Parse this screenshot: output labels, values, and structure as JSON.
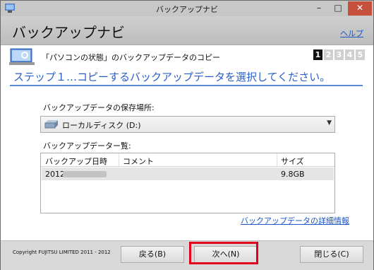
{
  "window": {
    "title": "バックアップナビ",
    "min_glyph": "–",
    "max_glyph": "□",
    "close_glyph": "✕"
  },
  "header": {
    "app_title": "バックアップナビ",
    "help_link": "ヘルプ"
  },
  "step": {
    "caption": "「パソコンの状態」のバックアップデータのコピー",
    "numbers": [
      "1",
      "2",
      "3",
      "4",
      "5"
    ],
    "active": 1,
    "heading": "ステップ１…コピーするバックアップデータを選択してください。"
  },
  "location": {
    "label": "バックアップデータの保存場所:",
    "value": "ローカルディスク (D:)"
  },
  "backup_list": {
    "label": "バックアップデーター覧:",
    "columns": [
      "バックアップ日時",
      "コメント",
      "サイズ"
    ],
    "rows": [
      {
        "date": "2012/",
        "comment": "",
        "size": "9.8GB"
      }
    ]
  },
  "detail_link": "バックアップデータの詳細情報",
  "footer": {
    "copyright": "Copyright FUJITSU LIMITED 2011 - 2012",
    "back_label": "戻る(B)",
    "next_label": "次へ(N)",
    "close_label": "閉じる(C)"
  },
  "colors": {
    "accent": "#2a5ec8",
    "link": "#1b56c4",
    "highlight": "#e0001b"
  },
  "icons": {
    "app": "app-icon",
    "pc": "pc-settings-icon",
    "drive": "drive-icon"
  }
}
